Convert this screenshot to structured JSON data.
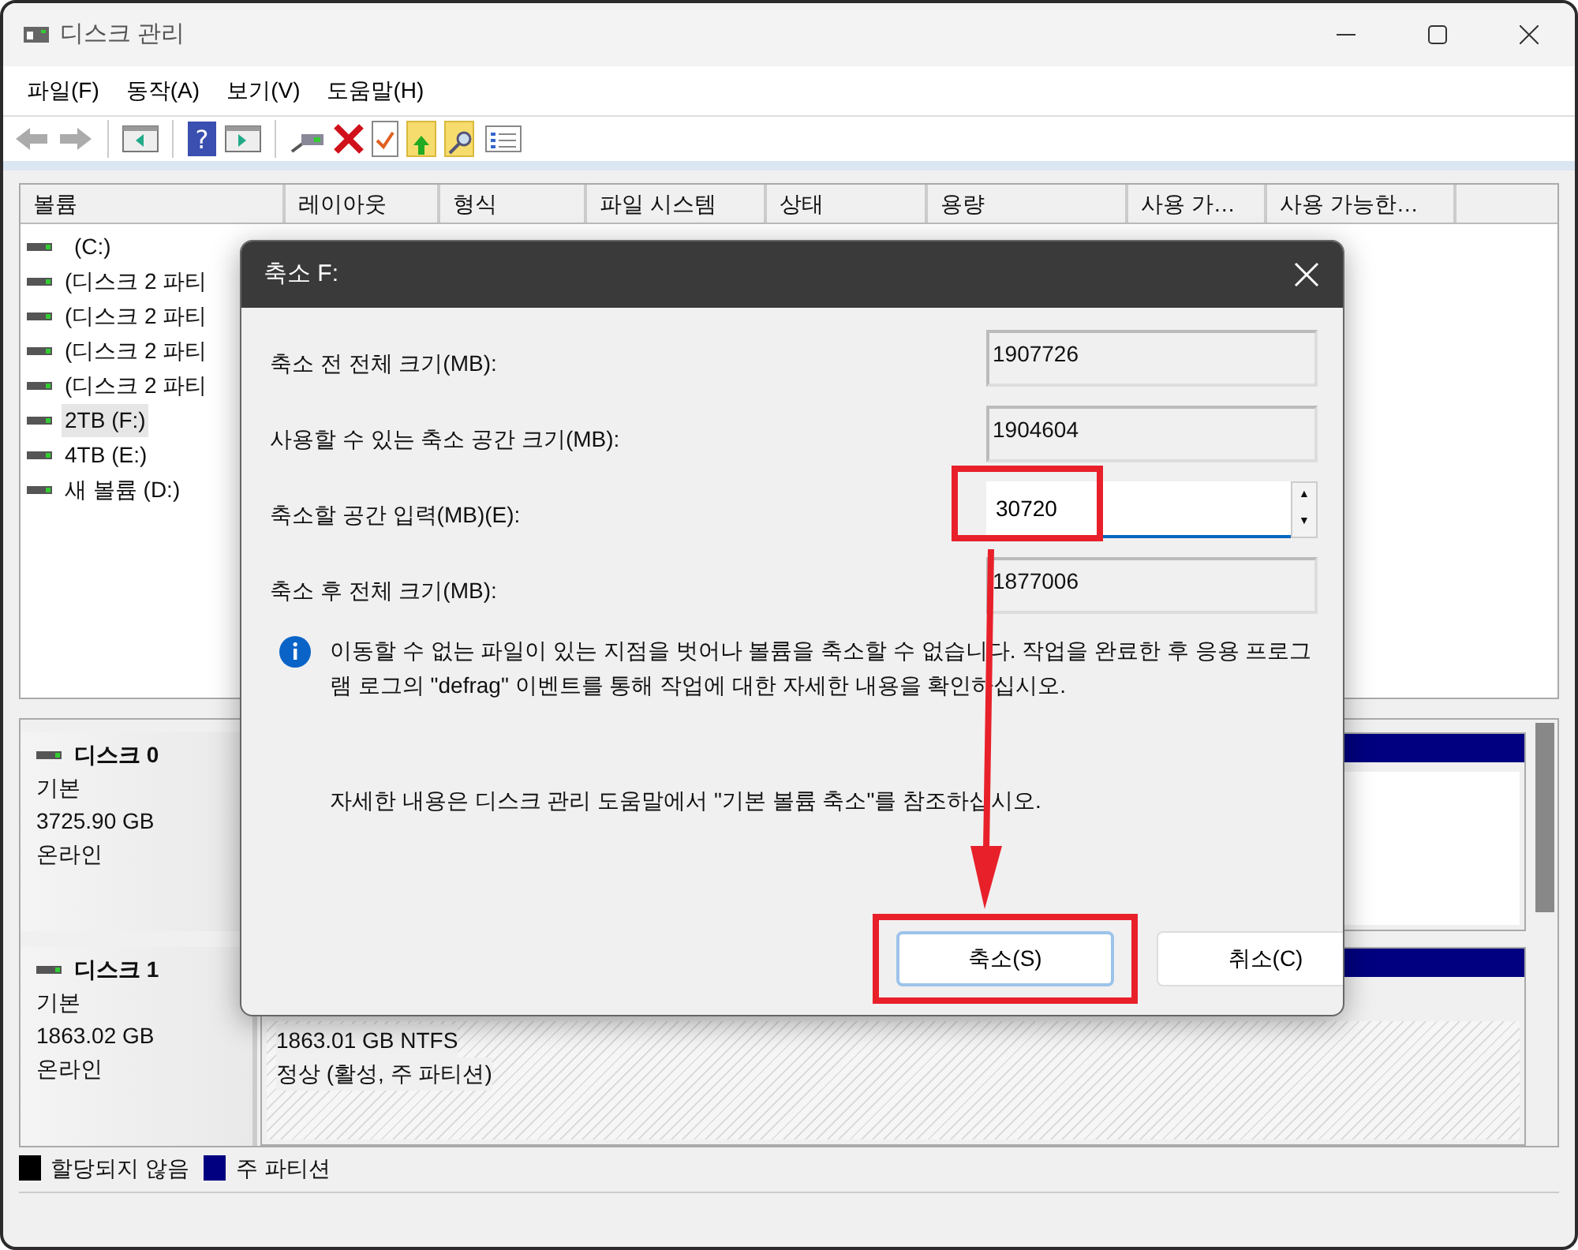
{
  "window": {
    "title": "디스크 관리"
  },
  "menu": [
    {
      "label": "파일(F)"
    },
    {
      "label": "동작(A)"
    },
    {
      "label": "보기(V)"
    },
    {
      "label": "도움말(H)"
    }
  ],
  "toolbar": [
    [
      {
        "kind": "back",
        "disabled": true
      },
      {
        "kind": "forward",
        "disabled": true
      }
    ],
    [
      {
        "kind": "panel-left",
        "disabled": false
      }
    ],
    [
      {
        "kind": "help",
        "disabled": false,
        "glyph": "?"
      },
      {
        "kind": "panel-right",
        "disabled": false
      }
    ],
    [
      {
        "kind": "connect",
        "disabled": false
      },
      {
        "kind": "delete",
        "disabled": false
      },
      {
        "kind": "check",
        "disabled": false
      },
      {
        "kind": "folder-up",
        "disabled": false
      },
      {
        "kind": "folder-search",
        "disabled": false
      },
      {
        "kind": "list",
        "disabled": false
      }
    ]
  ],
  "volume_list": {
    "columns": [
      "볼륨",
      "레이아웃",
      "형식",
      "파일 시스템",
      "상태",
      "용량",
      "사용 가…",
      "사용 가능한…"
    ],
    "rows": [
      {
        "name": "(C:)",
        "selected": false
      },
      {
        "name": "(디스크 2 파티",
        "selected": false
      },
      {
        "name": "(디스크 2 파티",
        "selected": false
      },
      {
        "name": "(디스크 2 파티",
        "selected": false
      },
      {
        "name": "(디스크 2 파티",
        "selected": false
      },
      {
        "name": "2TB (F:)",
        "selected": true
      },
      {
        "name": "4TB (E:)",
        "selected": false
      },
      {
        "name": "새 볼륨 (D:)",
        "selected": false
      }
    ]
  },
  "disks": [
    {
      "name": "디스크 0",
      "type": "기본",
      "size": "3725.90 GB",
      "status": "온라인",
      "partition": {
        "selected": false
      }
    },
    {
      "name": "디스크 1",
      "type": "기본",
      "size": "1863.02 GB",
      "status": "온라인",
      "partition": {
        "selected": true,
        "detail": "1863.01 GB NTFS",
        "status": "정상 (활성, 주 파티션)"
      }
    }
  ],
  "legend": [
    {
      "label": "할당되지 않음",
      "color": "#000000"
    },
    {
      "label": "주 파티션",
      "color": "#000080"
    }
  ],
  "dialog": {
    "title": "축소 F:",
    "fields": [
      {
        "label": "축소 전 전체 크기(MB):",
        "value": "1907726",
        "kind": "readonly",
        "highlighted": false
      },
      {
        "label": "사용할 수 있는 축소 공간 크기(MB):",
        "value": "1904604",
        "kind": "readonly",
        "highlighted": false
      },
      {
        "label": "축소할 공간 입력(MB)(E):",
        "value": "30720",
        "kind": "spin",
        "highlighted": true,
        "up": "▲",
        "down": "▼"
      },
      {
        "label": "축소 후 전체 크기(MB):",
        "value": "1877006",
        "kind": "readonly",
        "highlighted": false
      }
    ],
    "info": "이동할 수 없는 파일이 있는 지점을 벗어나 볼륨을 축소할 수 없습니다. 작업을 완료한 후 응용 프로그램 로그의 \"defrag\" 이벤트를 통해 작업에 대한 자세한 내용을 확인하십시오.",
    "help": "자세한 내용은 디스크 관리 도움말에서 \"기본 볼륨 축소\"를 참조하십시오.",
    "buttons": [
      {
        "label": "축소(S)",
        "default": true,
        "highlighted": true
      },
      {
        "label": "취소(C)",
        "default": false,
        "highlighted": false
      }
    ],
    "arrow": true
  }
}
